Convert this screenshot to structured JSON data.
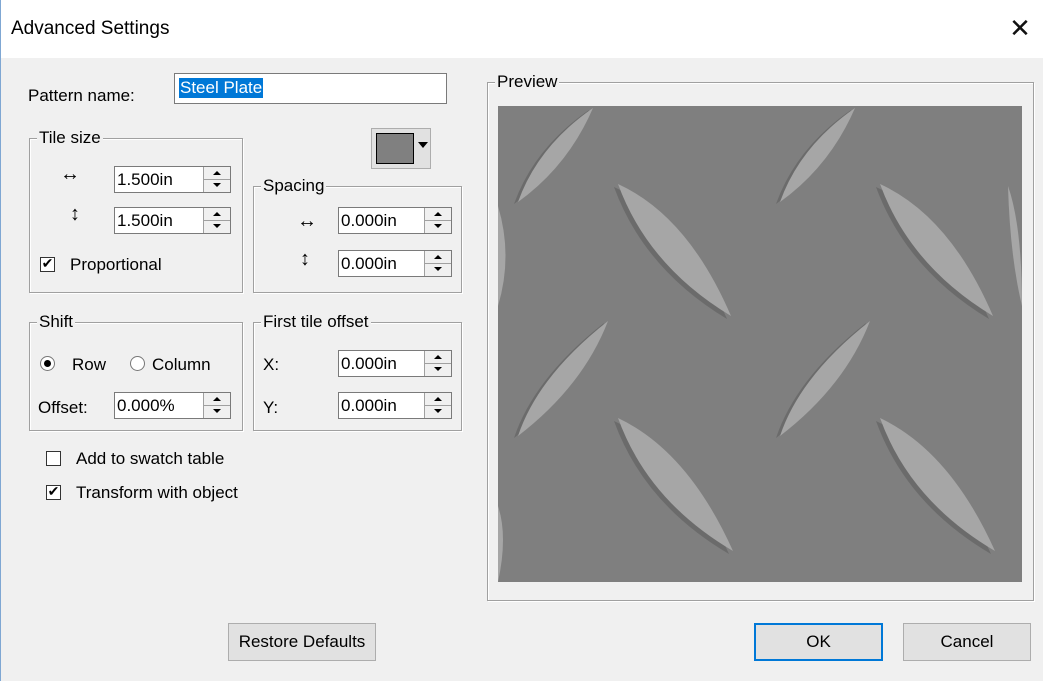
{
  "window": {
    "title": "Advanced Settings",
    "close_glyph": "✕"
  },
  "pattern_name": {
    "label": "Pattern name:",
    "value": "Steel Plate"
  },
  "tile_size": {
    "legend": "Tile size",
    "horizontal_icon": "↔",
    "vertical_icon": "↕",
    "width": "1.500in",
    "height": "1.500in",
    "proportional_label": "Proportional",
    "proportional_checked": true
  },
  "color_swatch": {
    "color": "#808080"
  },
  "spacing": {
    "legend": "Spacing",
    "horizontal_icon": "↔",
    "vertical_icon": "↕",
    "horizontal": "0.000in",
    "vertical": "0.000in"
  },
  "shift": {
    "legend": "Shift",
    "row_label": "Row",
    "column_label": "Column",
    "selected": "Row",
    "offset_label": "Offset:",
    "offset_value": "0.000%"
  },
  "first_tile_offset": {
    "legend": "First tile offset",
    "x_label": "X:",
    "x_value": "0.000in",
    "y_label": "Y:",
    "y_value": "0.000in"
  },
  "options": {
    "add_to_swatch_label": "Add to swatch table",
    "add_to_swatch_checked": false,
    "transform_label": "Transform with object",
    "transform_checked": true
  },
  "preview": {
    "legend": "Preview",
    "pattern": "steel-plate",
    "background": "#7f7f7f",
    "highlight": "#a6a6a6",
    "shadow": "#6b6b6b"
  },
  "buttons": {
    "restore_defaults": "Restore Defaults",
    "ok": "OK",
    "cancel": "Cancel"
  }
}
